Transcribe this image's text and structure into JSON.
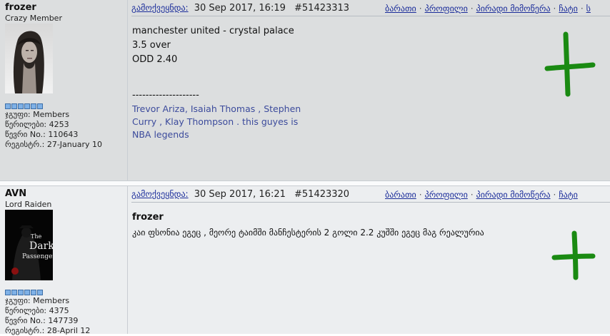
{
  "colors": {
    "link": "#1a2c9a",
    "signature": "#3c4b9c",
    "plus": "#1a8a12",
    "pip": "#7fb1e6"
  },
  "posts": [
    {
      "username": "frozer",
      "rank": "Crazy Member",
      "stats": [
        "ჯგუფი: Members",
        "წერილები: 4253",
        "წევრი No.: 110643",
        "რეგისტრ.: 27-January 10"
      ],
      "posted_label": "გამოქვეყნდა:",
      "date": "30 Sep 2017, 16:19",
      "post_id": "#51423313",
      "links": [
        "ბარათი",
        "პროფილი",
        "პირადი მიმოწერა",
        "ჩატი",
        "ს"
      ],
      "message_lines": [
        "manchester united - crystal palace",
        "3.5 over",
        "ODD 2.40"
      ],
      "signature_divider": "--------------------",
      "signature_lines": [
        "Trevor Ariza, Isaiah Thomas , Stephen",
        "Curry , Klay Thompson . this guyes is",
        "NBA legends"
      ],
      "plus_icon": "plus-icon"
    },
    {
      "username": "AVN",
      "rank": "Lord Raiden",
      "avatar_text": [
        "The",
        "Dark",
        "Passenger"
      ],
      "stats": [
        "ჯგუფი: Members",
        "წერილები: 4375",
        "წევრი No.: 147739",
        "რეგისტრ.: 28-April 12"
      ],
      "posted_label": "გამოქვეყნდა:",
      "date": "30 Sep 2017, 16:21",
      "post_id": "#51423320",
      "links": [
        "ბარათი",
        "პროფილი",
        "პირადი მიმოწერა",
        "ჩატი"
      ],
      "quote_author": "frozer",
      "message_line": "კაი ფსონია ეგეც , მეორე ტაიმში მანჩესტერის 2 გოლი 2.2 კუშში ეგეც მაგ რეალურია",
      "plus_icon": "plus-icon"
    }
  ]
}
